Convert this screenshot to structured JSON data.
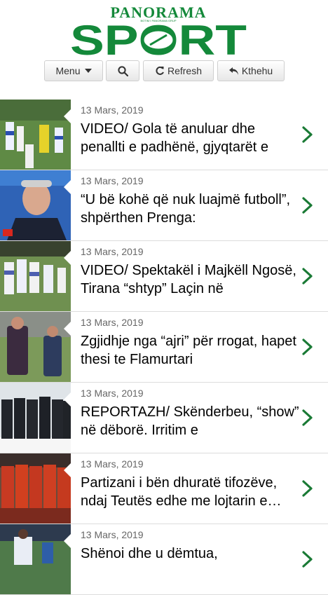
{
  "logo": {
    "top_text": "PANORAMA",
    "main_text": "SPORT",
    "tagline": "BOTIM I PANORAMA GRUP"
  },
  "toolbar": {
    "menu_label": "Menu",
    "refresh_label": "Refresh",
    "back_label": "Kthehu"
  },
  "colors": {
    "brand_green": "#14893a",
    "chevron_green": "#1a7a35"
  },
  "articles": [
    {
      "date": "13 Mars, 2019",
      "title": "VIDEO/ Gola të anuluar dhe penallti e padhënë, gjyqtarët e"
    },
    {
      "date": "13 Mars, 2019",
      "title": "“U bë kohë që nuk luajmë futboll”, shpërthen Prenga:"
    },
    {
      "date": "13 Mars, 2019",
      "title": "VIDEO/ Spektakël i Majkëll Ngosë, Tirana “shtyp” Laçin në"
    },
    {
      "date": "13 Mars, 2019",
      "title": "Zgjidhje nga “ajri” për rrogat, hapet thesi te Flamurtari"
    },
    {
      "date": "13 Mars, 2019",
      "title": "REPORTAZH/ Skënderbeu, “show” në dëborë. Irritim e"
    },
    {
      "date": "13 Mars, 2019",
      "title": "Partizani i bën dhuratë tifozëve, ndaj Teutës edhe me lojtarin e…"
    },
    {
      "date": "13 Mars, 2019",
      "title": "Shënoi dhe u dëmtua,"
    }
  ]
}
